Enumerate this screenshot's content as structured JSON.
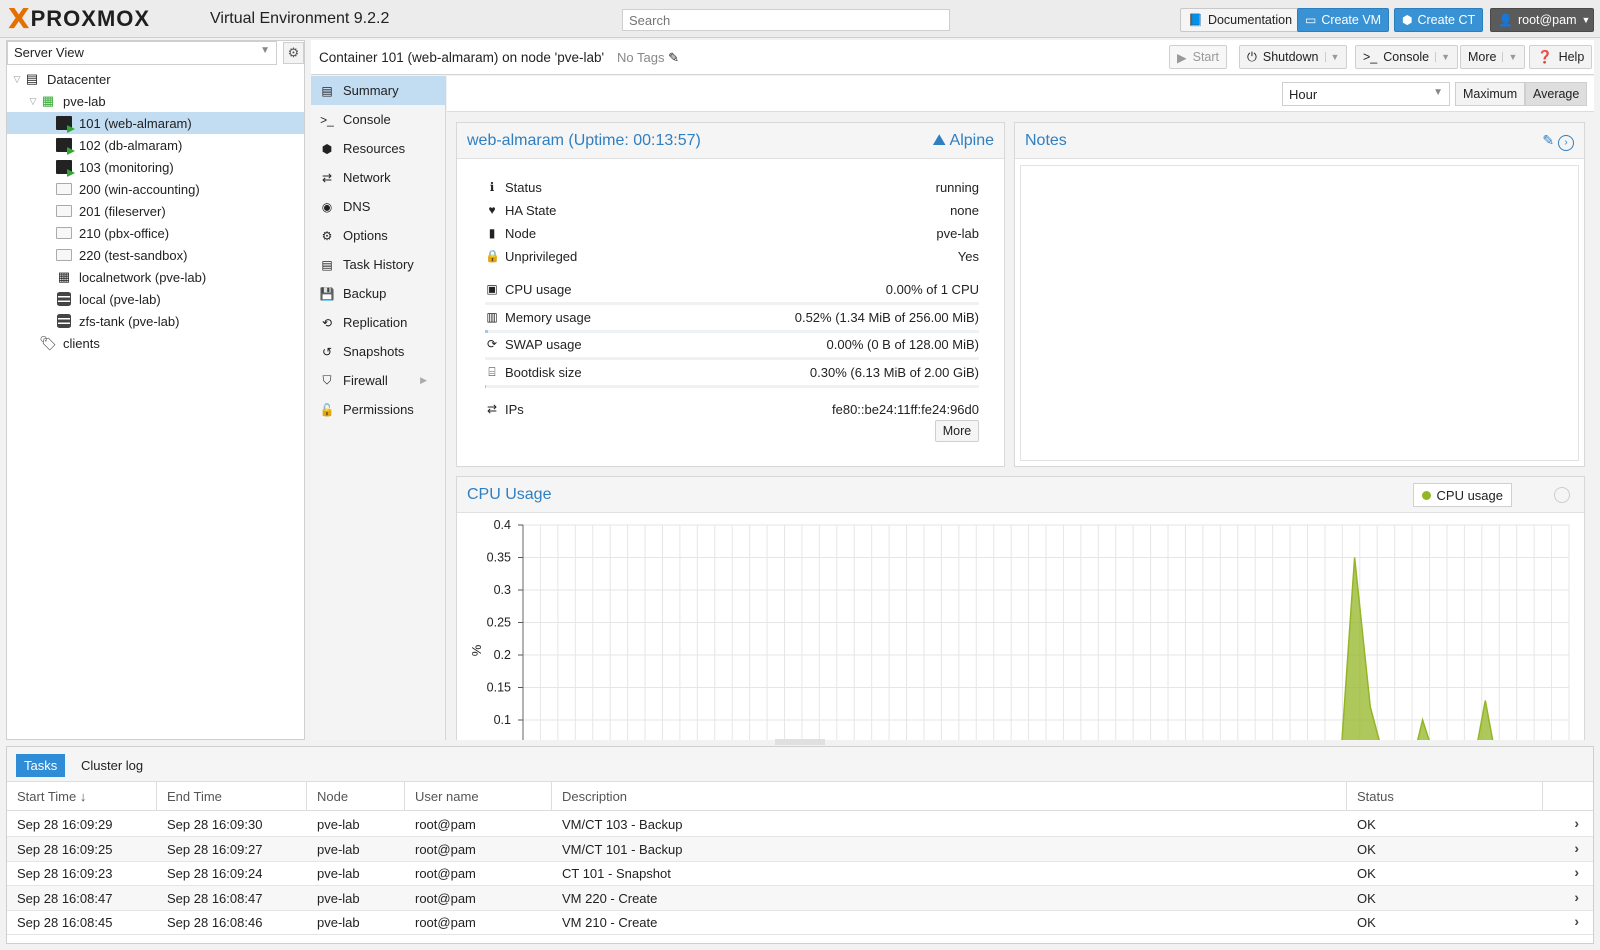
{
  "topbar": {
    "logo_x": "X",
    "logo_text": "PROXMOX",
    "version": "Virtual Environment 9.2.2",
    "search_placeholder": "Search",
    "documentation": "Documentation",
    "create_vm": "Create VM",
    "create_ct": "Create CT",
    "user": "root@pam"
  },
  "tree": {
    "view": "Server View",
    "items": [
      {
        "label": "Datacenter"
      },
      {
        "label": "pve-lab"
      },
      {
        "label": "101 (web-almaram)"
      },
      {
        "label": "102 (db-almaram)"
      },
      {
        "label": "103 (monitoring)"
      },
      {
        "label": "200 (win-accounting)"
      },
      {
        "label": "201 (fileserver)"
      },
      {
        "label": "210 (pbx-office)"
      },
      {
        "label": "220 (test-sandbox)"
      },
      {
        "label": "localnetwork (pve-lab)"
      },
      {
        "label": "local (pve-lab)"
      },
      {
        "label": "zfs-tank (pve-lab)"
      },
      {
        "label": "clients"
      }
    ]
  },
  "header": {
    "title": "Container 101 (web-almaram) on node 'pve-lab'",
    "tags": "No Tags",
    "start": "Start",
    "shutdown": "Shutdown",
    "console": "Console",
    "more": "More",
    "help": "Help"
  },
  "nav": {
    "items": [
      {
        "label": "Summary"
      },
      {
        "label": "Console"
      },
      {
        "label": "Resources"
      },
      {
        "label": "Network"
      },
      {
        "label": "DNS"
      },
      {
        "label": "Options"
      },
      {
        "label": "Task History"
      },
      {
        "label": "Backup"
      },
      {
        "label": "Replication"
      },
      {
        "label": "Snapshots"
      },
      {
        "label": "Firewall"
      },
      {
        "label": "Permissions"
      }
    ]
  },
  "timeframe": {
    "selected": "Hour",
    "maximum": "Maximum",
    "average": "Average"
  },
  "status_panel": {
    "title": "web-almaram (Uptime: 00:13:57)",
    "os": "Alpine",
    "rows": [
      {
        "key": "Status",
        "value": "running"
      },
      {
        "key": "HA State",
        "value": "none"
      },
      {
        "key": "Node",
        "value": "pve-lab"
      },
      {
        "key": "Unprivileged",
        "value": "Yes"
      }
    ],
    "usage": [
      {
        "key": "CPU usage",
        "value": "0.00% of 1 CPU",
        "fraction": 0.0
      },
      {
        "key": "Memory usage",
        "value": "0.52% (1.34 MiB of 256.00 MiB)",
        "fraction": 0.0052
      },
      {
        "key": "SWAP usage",
        "value": "0.00% (0 B of 128.00 MiB)",
        "fraction": 0.0
      },
      {
        "key": "Bootdisk size",
        "value": "0.30% (6.13 MiB of 2.00 GiB)",
        "fraction": 0.003
      }
    ],
    "ips_label": "IPs",
    "ips_value": "fe80::be24:11ff:fe24:96d0",
    "more": "More"
  },
  "notes_panel": {
    "title": "Notes"
  },
  "cpu_panel": {
    "title": "CPU Usage",
    "legend": "CPU usage"
  },
  "chart_data": {
    "type": "area",
    "ylabel": "%",
    "yticks": [
      "0.4",
      "0.35",
      "0.3",
      "0.25",
      "0.2",
      "0.15",
      "0.1"
    ],
    "ylim": [
      0.06,
      0.4
    ],
    "xlim": [
      0,
      1
    ],
    "grid": true,
    "series": [
      {
        "name": "CPU usage",
        "color": "#94b526",
        "x": [
          0.0,
          0.78,
          0.795,
          0.81,
          0.83,
          0.845,
          0.86,
          0.88,
          0.905,
          0.92,
          0.935
        ],
        "values": [
          0.0,
          0.0,
          0.35,
          0.12,
          0.0,
          0.0,
          0.1,
          0.0,
          0.0,
          0.13,
          0.0
        ]
      }
    ]
  },
  "bottom": {
    "tab_tasks": "Tasks",
    "tab_cluster": "Cluster log",
    "columns": [
      "Start Time",
      "End Time",
      "Node",
      "User name",
      "Description",
      "Status"
    ],
    "rows": [
      [
        "Sep 28 16:09:29",
        "Sep 28 16:09:30",
        "pve-lab",
        "root@pam",
        "VM/CT 103 - Backup",
        "OK"
      ],
      [
        "Sep 28 16:09:25",
        "Sep 28 16:09:27",
        "pve-lab",
        "root@pam",
        "VM/CT 101 - Backup",
        "OK"
      ],
      [
        "Sep 28 16:09:23",
        "Sep 28 16:09:24",
        "pve-lab",
        "root@pam",
        "CT 101 - Snapshot",
        "OK"
      ],
      [
        "Sep 28 16:08:47",
        "Sep 28 16:08:47",
        "pve-lab",
        "root@pam",
        "VM 220 - Create",
        "OK"
      ],
      [
        "Sep 28 16:08:45",
        "Sep 28 16:08:46",
        "pve-lab",
        "root@pam",
        "VM 210 - Create",
        "OK"
      ]
    ]
  }
}
